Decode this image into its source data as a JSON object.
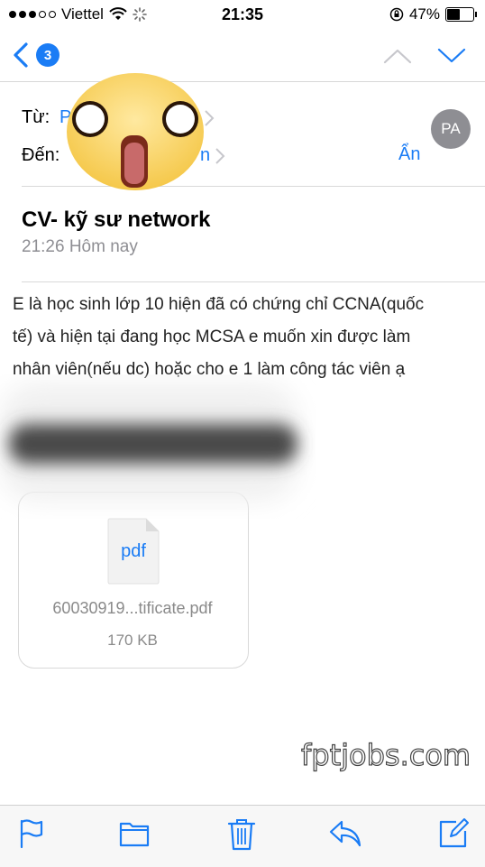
{
  "status_bar": {
    "carrier": "Viettel",
    "time": "21:35",
    "battery_percent": "47%",
    "signal_bars": 3,
    "icons": [
      "signal-icon",
      "wifi-icon",
      "activity-spinner-icon",
      "rotation-lock-icon",
      "battery-icon"
    ]
  },
  "nav": {
    "back_count": "3",
    "icons": [
      "back-chevron-icon",
      "previous-message-icon",
      "next-message-icon"
    ]
  },
  "header": {
    "from_label": "Từ:",
    "from_value_partial": "P",
    "to_label": "Đến:",
    "to_value_partial": "n",
    "hide_label": "Ẩn",
    "avatar_initials": "PA"
  },
  "message": {
    "subject": "CV- kỹ sư network",
    "datetime": "21:26 Hôm nay",
    "body_lines": [
      "E là học sinh lớp 10 hiện đã có chứng chỉ CCNA(quốc",
      "tế) và hiện tại đang học MCSA e muốn xin được làm",
      "nhân viên(nếu dc) hoặc cho e 1 làm công tác viên ạ"
    ]
  },
  "attachment": {
    "type_label": "pdf",
    "filename": "60030919...tificate.pdf",
    "size": "170 KB"
  },
  "watermark": "fptjobs.com",
  "toolbar": {
    "icons": [
      "flag-icon",
      "folder-icon",
      "trash-icon",
      "reply-icon",
      "compose-icon"
    ]
  },
  "colors": {
    "accent": "#1a7cf5",
    "secondary_text": "#8e8e93",
    "separator": "#d8d8d8"
  }
}
